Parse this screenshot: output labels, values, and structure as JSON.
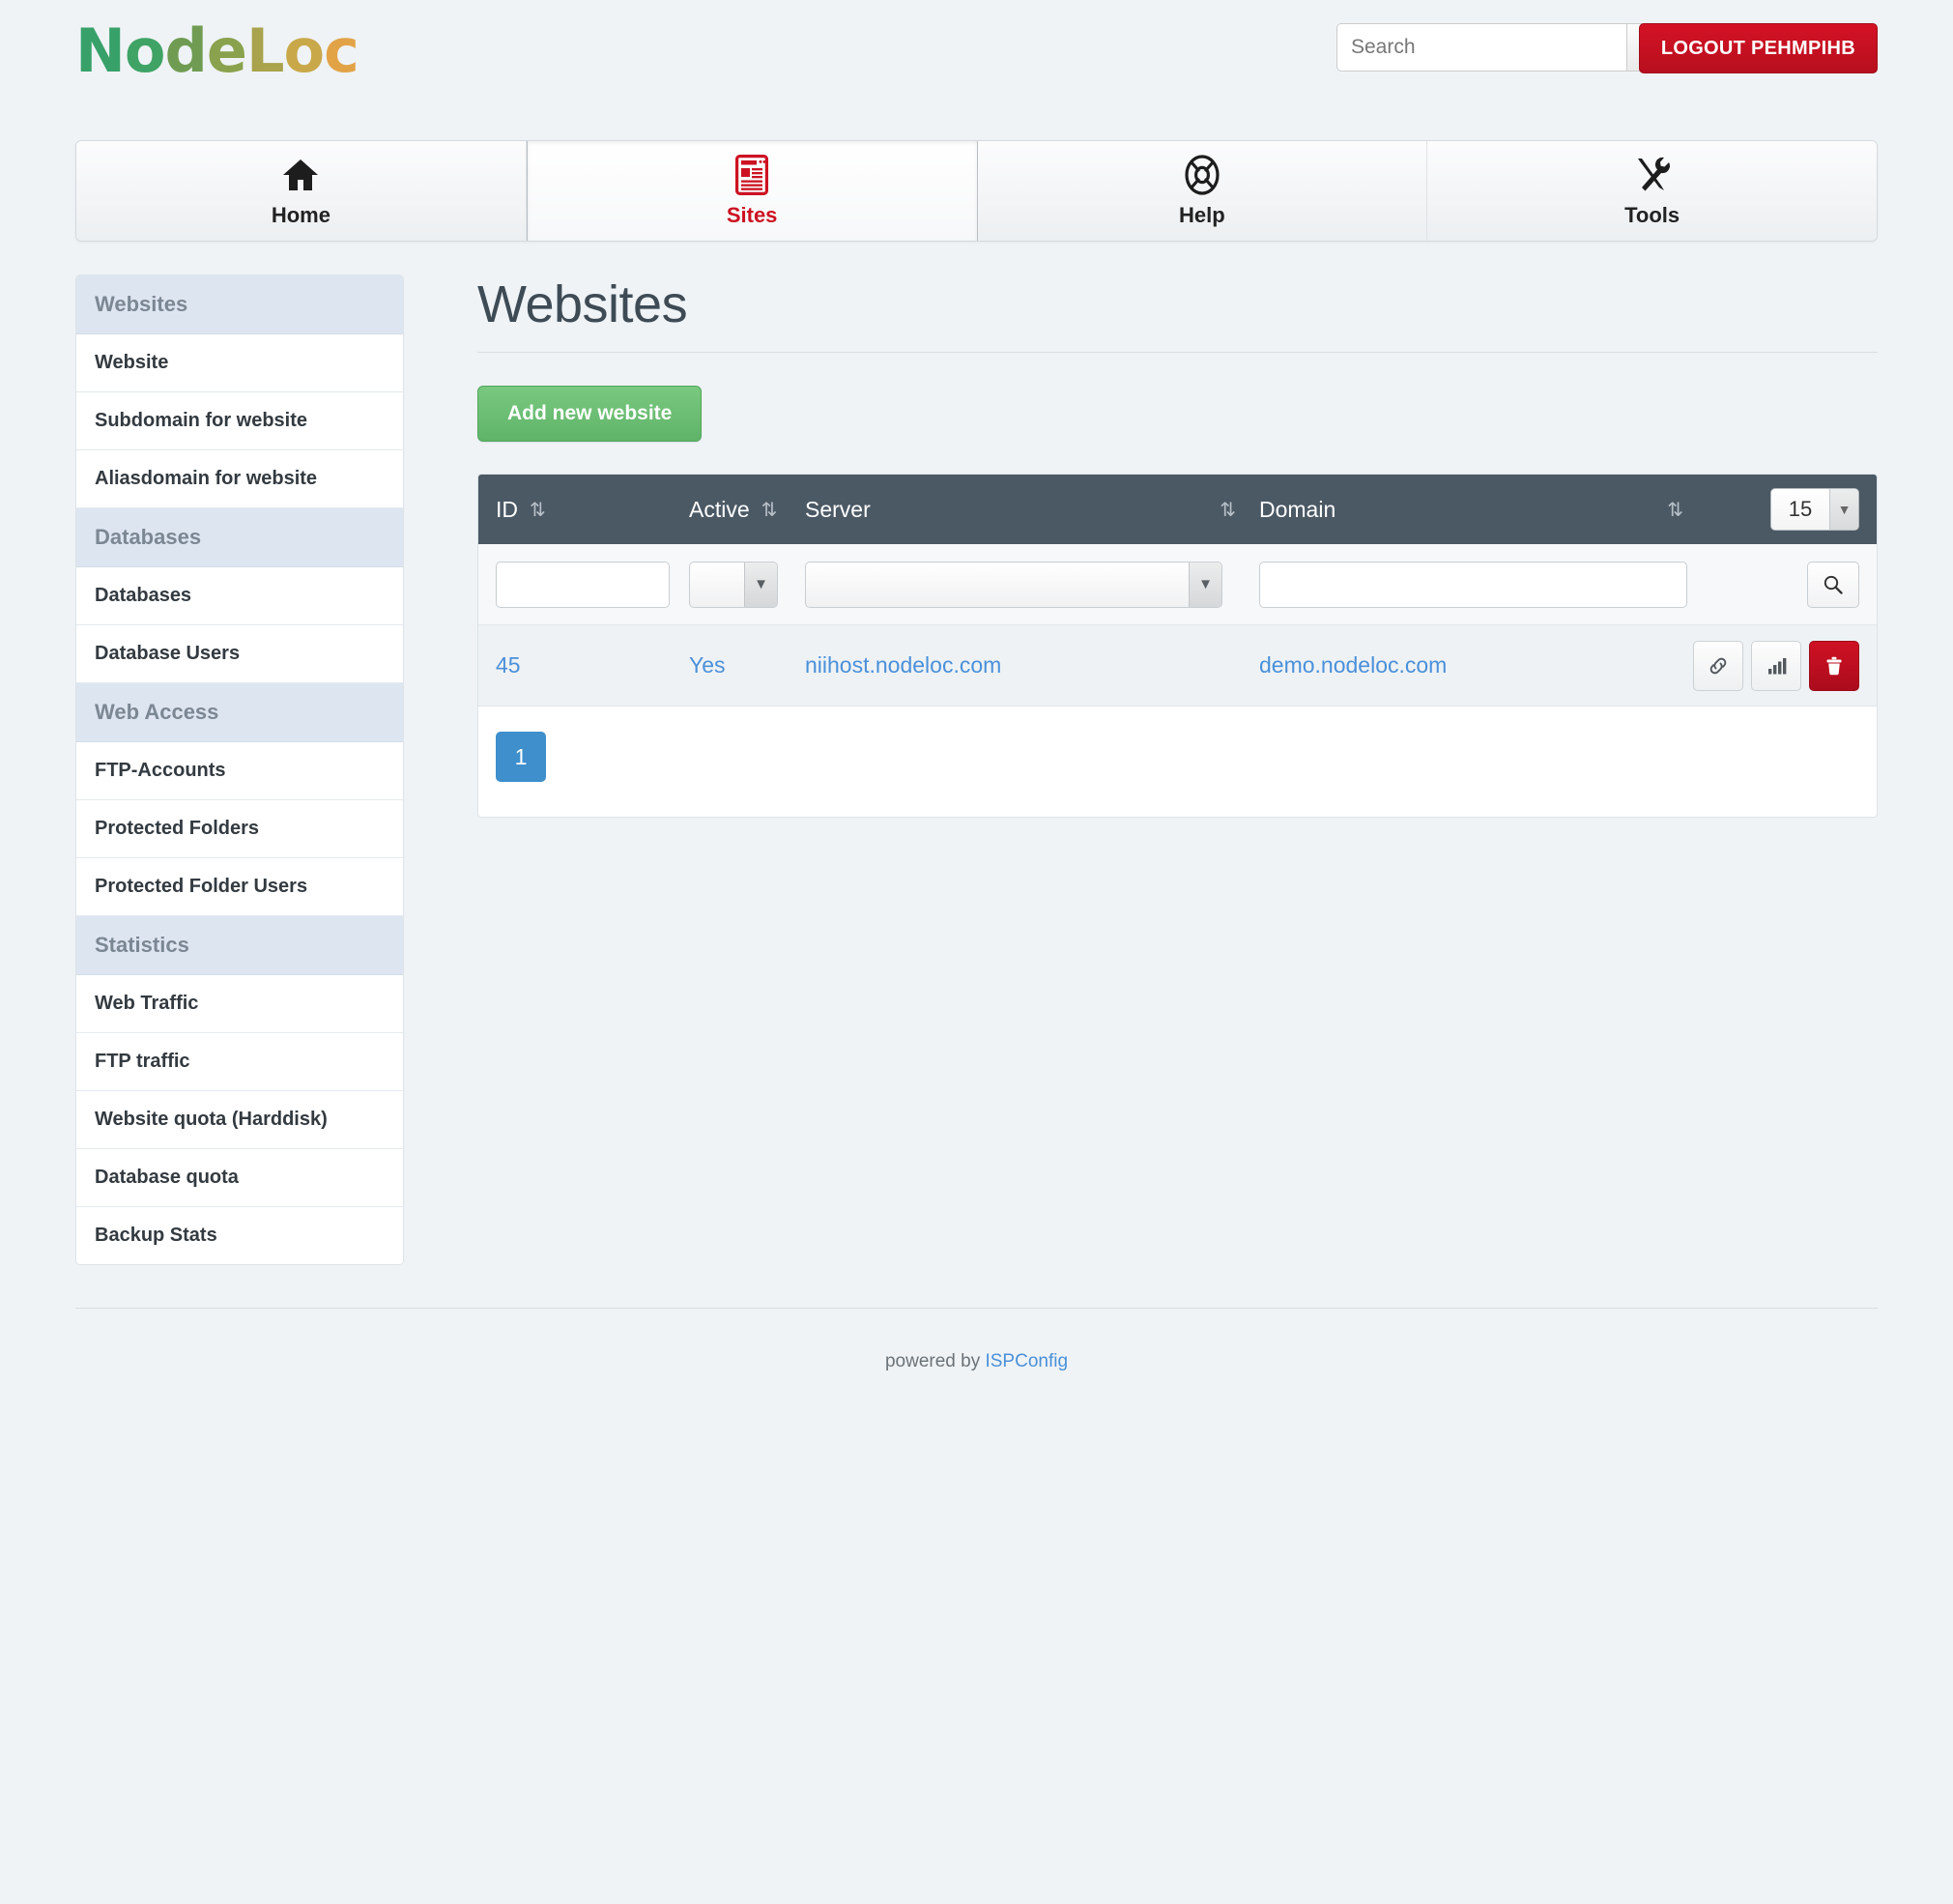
{
  "header": {
    "logo_text": "NodeLoc",
    "logo_letters": [
      "N",
      "o",
      "d",
      "e",
      "L",
      "o",
      "c"
    ],
    "search_placeholder": "Search",
    "search_value": "",
    "search_button_icon": "search-icon",
    "logout_label": "LOGOUT PEHMPIHB"
  },
  "tabs": [
    {
      "label": "Home",
      "icon": "home-icon",
      "active": false
    },
    {
      "label": "Sites",
      "icon": "newspaper-icon",
      "active": true
    },
    {
      "label": "Help",
      "icon": "lifebuoy-icon",
      "active": false
    },
    {
      "label": "Tools",
      "icon": "tools-icon",
      "active": false
    }
  ],
  "sidebar": [
    {
      "type": "head",
      "label": "Websites"
    },
    {
      "type": "item",
      "label": "Website"
    },
    {
      "type": "item",
      "label": "Subdomain for website"
    },
    {
      "type": "item",
      "label": "Aliasdomain for website"
    },
    {
      "type": "head",
      "label": "Databases"
    },
    {
      "type": "item",
      "label": "Databases"
    },
    {
      "type": "item",
      "label": "Database Users"
    },
    {
      "type": "head",
      "label": "Web Access"
    },
    {
      "type": "item",
      "label": "FTP-Accounts"
    },
    {
      "type": "item",
      "label": "Protected Folders"
    },
    {
      "type": "item",
      "label": "Protected Folder Users"
    },
    {
      "type": "head",
      "label": "Statistics"
    },
    {
      "type": "item",
      "label": "Web Traffic"
    },
    {
      "type": "item",
      "label": "FTP traffic"
    },
    {
      "type": "item",
      "label": "Website quota (Harddisk)"
    },
    {
      "type": "item",
      "label": "Database quota"
    },
    {
      "type": "item",
      "label": "Backup Stats"
    }
  ],
  "main": {
    "title": "Websites",
    "add_button_label": "Add new website",
    "table": {
      "columns": [
        {
          "key": "id",
          "label": "ID",
          "sortable": true
        },
        {
          "key": "active",
          "label": "Active",
          "sortable": true
        },
        {
          "key": "server",
          "label": "Server",
          "sortable": true
        },
        {
          "key": "domain",
          "label": "Domain",
          "sortable": true
        }
      ],
      "sort_icon": "⇅",
      "per_page": "15",
      "per_page_arrow_icon": "chevron-down-icon",
      "filters": {
        "id_value": "",
        "active_value": "",
        "server_value": "",
        "domain_value": "",
        "search_button_icon": "search-icon"
      },
      "rows": [
        {
          "id": "45",
          "active": "Yes",
          "server": "niihost.nodeloc.com",
          "domain": "demo.nodeloc.com",
          "actions": [
            {
              "name": "link-icon",
              "style": "default"
            },
            {
              "name": "bar-chart-icon",
              "style": "default"
            },
            {
              "name": "trash-icon",
              "style": "danger"
            }
          ]
        }
      ],
      "pagination": [
        "1"
      ]
    }
  },
  "footer": {
    "powered_prefix": "powered by ",
    "powered_link": "ISPConfig"
  },
  "colors": {
    "page_bg": "#eff3f6",
    "accent_red": "#cc1122",
    "accent_blue": "#4a90d9",
    "accent_green": "#5fb469",
    "table_header": "#4b5965",
    "nav_head_bg": "#dde6f0"
  }
}
